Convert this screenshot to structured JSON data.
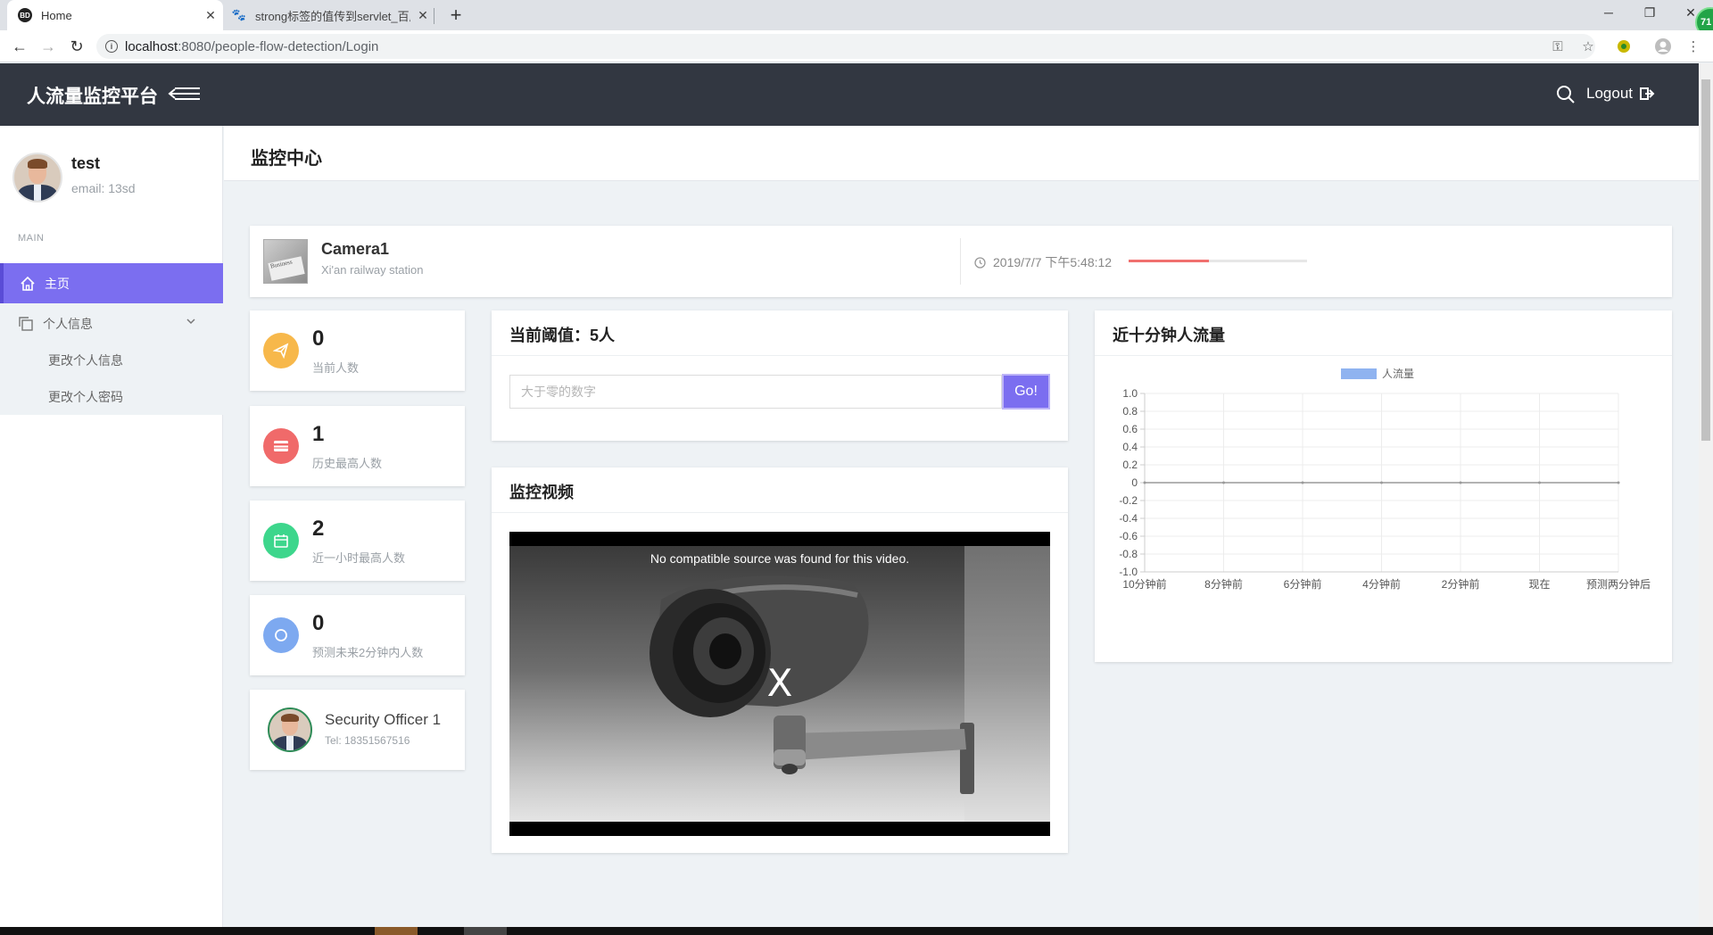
{
  "browser": {
    "tabs": [
      {
        "title": "Home",
        "favicon": "BD"
      },
      {
        "title": "strong标签的值传到servlet_百度"
      }
    ],
    "url_host": "localhost",
    "url_path": ":8080/people-flow-detection/Login",
    "badge": "71"
  },
  "header": {
    "brand": "人流量监控平台",
    "logout_label": "Logout"
  },
  "sidebar": {
    "user_name": "test",
    "user_email": "email: 13sd",
    "section": "MAIN",
    "nav_home": "主页",
    "nav_personal": "个人信息",
    "nav_edit_info": "更改个人信息",
    "nav_edit_password": "更改个人密码"
  },
  "page_title": "监控中心",
  "camera": {
    "name": "Camera1",
    "location": "Xi'an railway station",
    "time": "2019/7/7 下午5:48:12",
    "progress_fraction": 0.45
  },
  "stats": [
    {
      "value": "0",
      "label": "当前人数",
      "color": "#f7b84b"
    },
    {
      "value": "1",
      "label": "历史最高人数",
      "color": "#f06a6a"
    },
    {
      "value": "2",
      "label": "近一小时最高人数",
      "color": "#3dd68c"
    },
    {
      "value": "0",
      "label": "预测未来2分钟内人数",
      "color": "#7da9f0"
    }
  ],
  "officer": {
    "name": "Security Officer 1",
    "tel": "Tel: 18351567516"
  },
  "threshold": {
    "title": "当前阈值：5人",
    "placeholder": "大于零的数字",
    "button": "Go!"
  },
  "video": {
    "title": "监控视频",
    "message": "No compatible source was found for this video.",
    "close_glyph": "X"
  },
  "flow_chart": {
    "title": "近十分钟人流量"
  },
  "colors": {
    "accent": "#7b6ef0",
    "header_bg": "#323741",
    "series": "#8fb3f0"
  },
  "chart_data": {
    "type": "line",
    "categories": [
      "10分钟前",
      "8分钟前",
      "6分钟前",
      "4分钟前",
      "2分钟前",
      "现在",
      "预测两分钟后"
    ],
    "series": [
      {
        "name": "人流量",
        "values": [
          0,
          0,
          0,
          0,
          0,
          0,
          0
        ]
      }
    ],
    "ylim": [
      -1.0,
      1.0
    ],
    "yticks": [
      "1.0",
      "0.8",
      "0.6",
      "0.4",
      "0.2",
      "0",
      "-0.2",
      "-0.4",
      "-0.6",
      "-0.8",
      "-1.0"
    ],
    "legend": "top",
    "grid": true
  }
}
